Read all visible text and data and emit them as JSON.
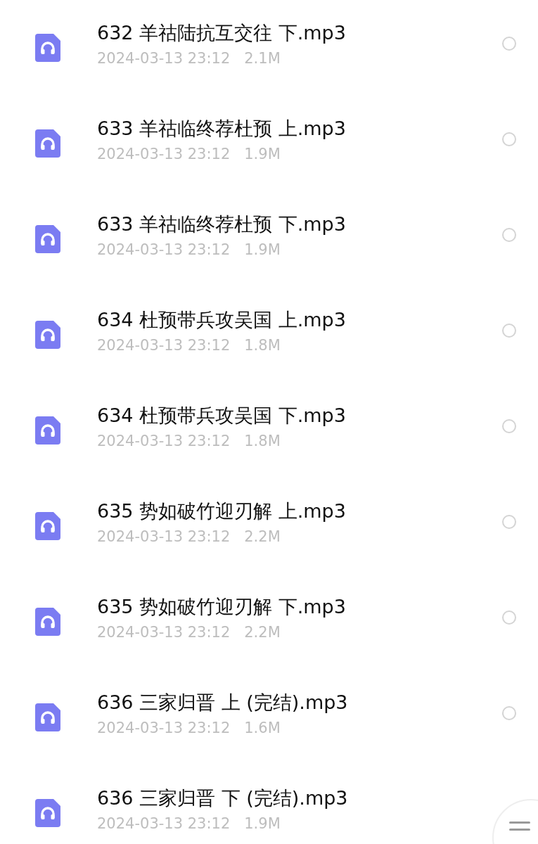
{
  "files": [
    {
      "name": "632 羊祜陆抗互交往 下.mp3",
      "date": "2024-03-13 23:12",
      "size": "2.1M",
      "selected": false
    },
    {
      "name": "633 羊祜临终荐杜预 上.mp3",
      "date": "2024-03-13 23:12",
      "size": "1.9M",
      "selected": false
    },
    {
      "name": "633 羊祜临终荐杜预 下.mp3",
      "date": "2024-03-13 23:12",
      "size": "1.9M",
      "selected": false
    },
    {
      "name": "634 杜预带兵攻吴国 上.mp3",
      "date": "2024-03-13 23:12",
      "size": "1.8M",
      "selected": false
    },
    {
      "name": "634 杜预带兵攻吴国 下.mp3",
      "date": "2024-03-13 23:12",
      "size": "1.8M",
      "selected": false
    },
    {
      "name": "635 势如破竹迎刃解 上.mp3",
      "date": "2024-03-13 23:12",
      "size": "2.2M",
      "selected": false
    },
    {
      "name": "635 势如破竹迎刃解 下.mp3",
      "date": "2024-03-13 23:12",
      "size": "2.2M",
      "selected": false
    },
    {
      "name": "636 三家归晋 上 (完结).mp3",
      "date": "2024-03-13 23:12",
      "size": "1.6M",
      "selected": false
    },
    {
      "name": "636 三家归晋 下 (完结).mp3",
      "date": "2024-03-13 23:12",
      "size": "1.9M"
    }
  ]
}
